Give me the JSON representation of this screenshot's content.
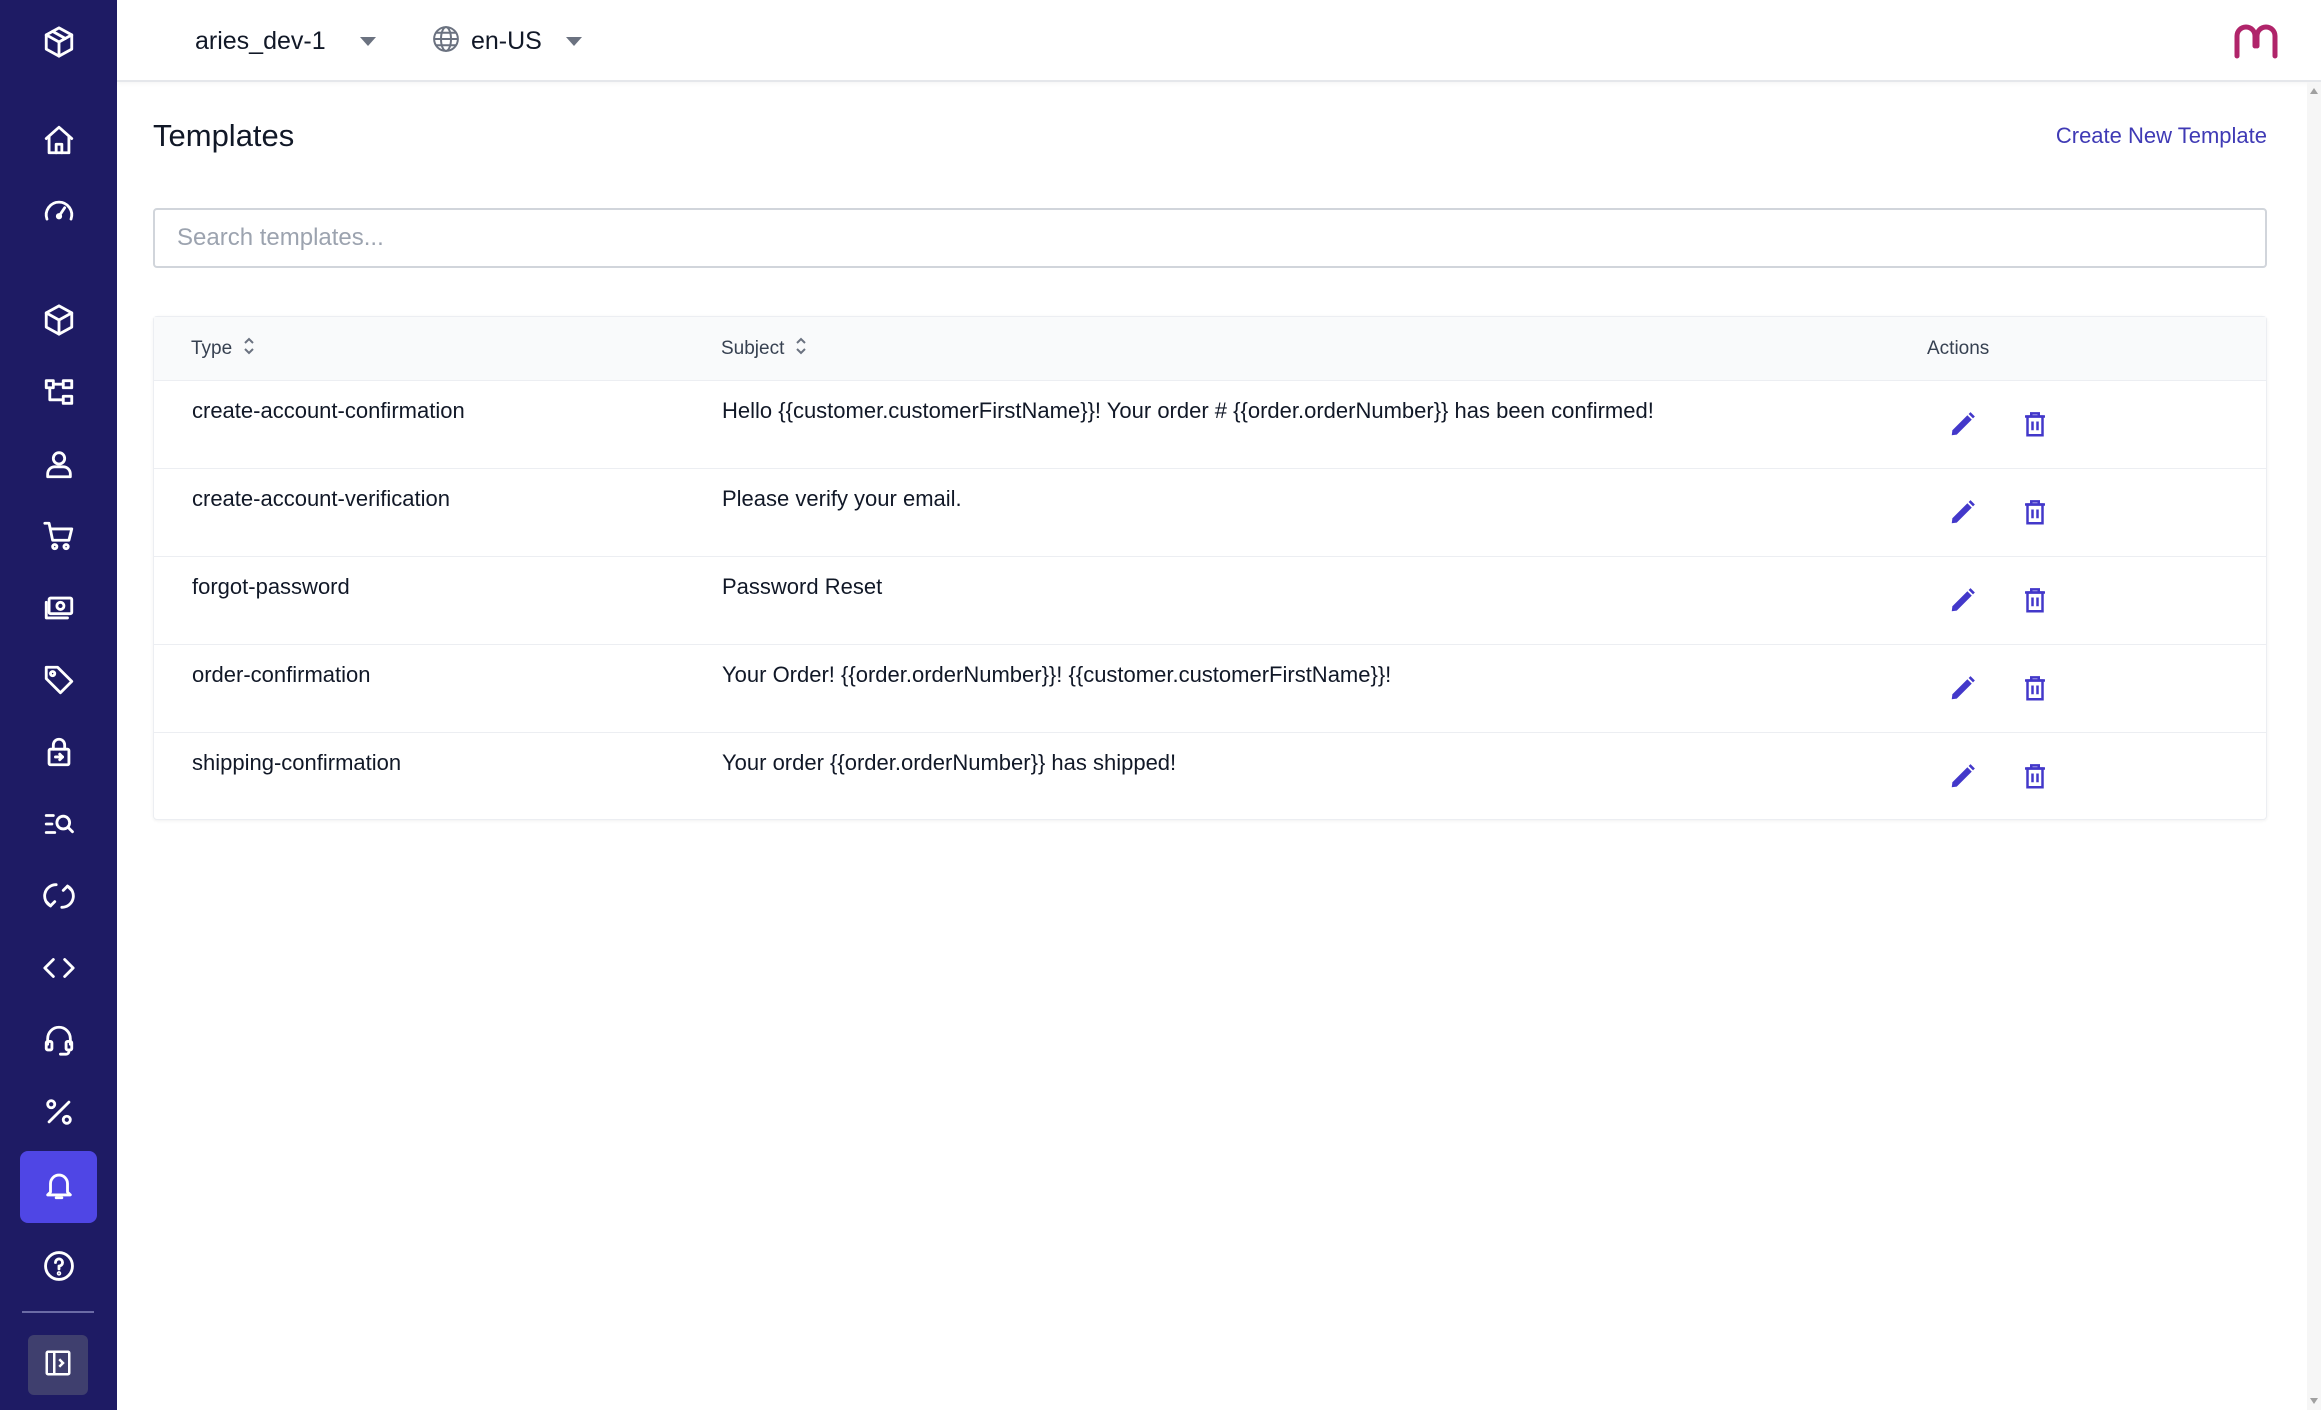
{
  "sidebar": {
    "logo_icon": "cube-logo-icon",
    "items": [
      {
        "icon": "home-icon"
      },
      {
        "icon": "dashboard-gauge-icon"
      },
      {
        "icon": "box-icon"
      },
      {
        "icon": "hierarchy-icon"
      },
      {
        "icon": "user-icon"
      },
      {
        "icon": "cart-icon"
      },
      {
        "icon": "money-icon"
      },
      {
        "icon": "tag-icon"
      },
      {
        "icon": "lock-icon"
      },
      {
        "icon": "search-list-icon"
      },
      {
        "icon": "sync-icon"
      },
      {
        "icon": "code-icon"
      },
      {
        "icon": "headset-icon"
      },
      {
        "icon": "percent-icon"
      },
      {
        "icon": "bell-icon",
        "active": true
      },
      {
        "icon": "help-icon"
      }
    ],
    "collapse_icon": "sidebar-collapse-icon",
    "bg_color": "#1e1b64",
    "active_color": "#4f46e5"
  },
  "header": {
    "org": "aries_dev-1",
    "locale": "en-US"
  },
  "main": {
    "title": "Templates",
    "create_label": "Create New Template",
    "search_placeholder": "Search templates...",
    "accent_color": "#3f3ab5"
  },
  "table": {
    "columns": {
      "type": "Type",
      "subject": "Subject",
      "actions": "Actions"
    },
    "rows": [
      {
        "type": "create-account-confirmation",
        "subject": "Hello {{customer.customerFirstName}}! Your order # {{order.orderNumber}} has been confirmed!"
      },
      {
        "type": "create-account-verification",
        "subject": "Please verify your email."
      },
      {
        "type": "forgot-password",
        "subject": "Password Reset"
      },
      {
        "type": "order-confirmation",
        "subject": "Your Order! {{order.orderNumber}}! {{customer.customerFirstName}}!"
      },
      {
        "type": "shipping-confirmation",
        "subject": "Your order {{order.orderNumber}} has shipped!"
      }
    ]
  }
}
